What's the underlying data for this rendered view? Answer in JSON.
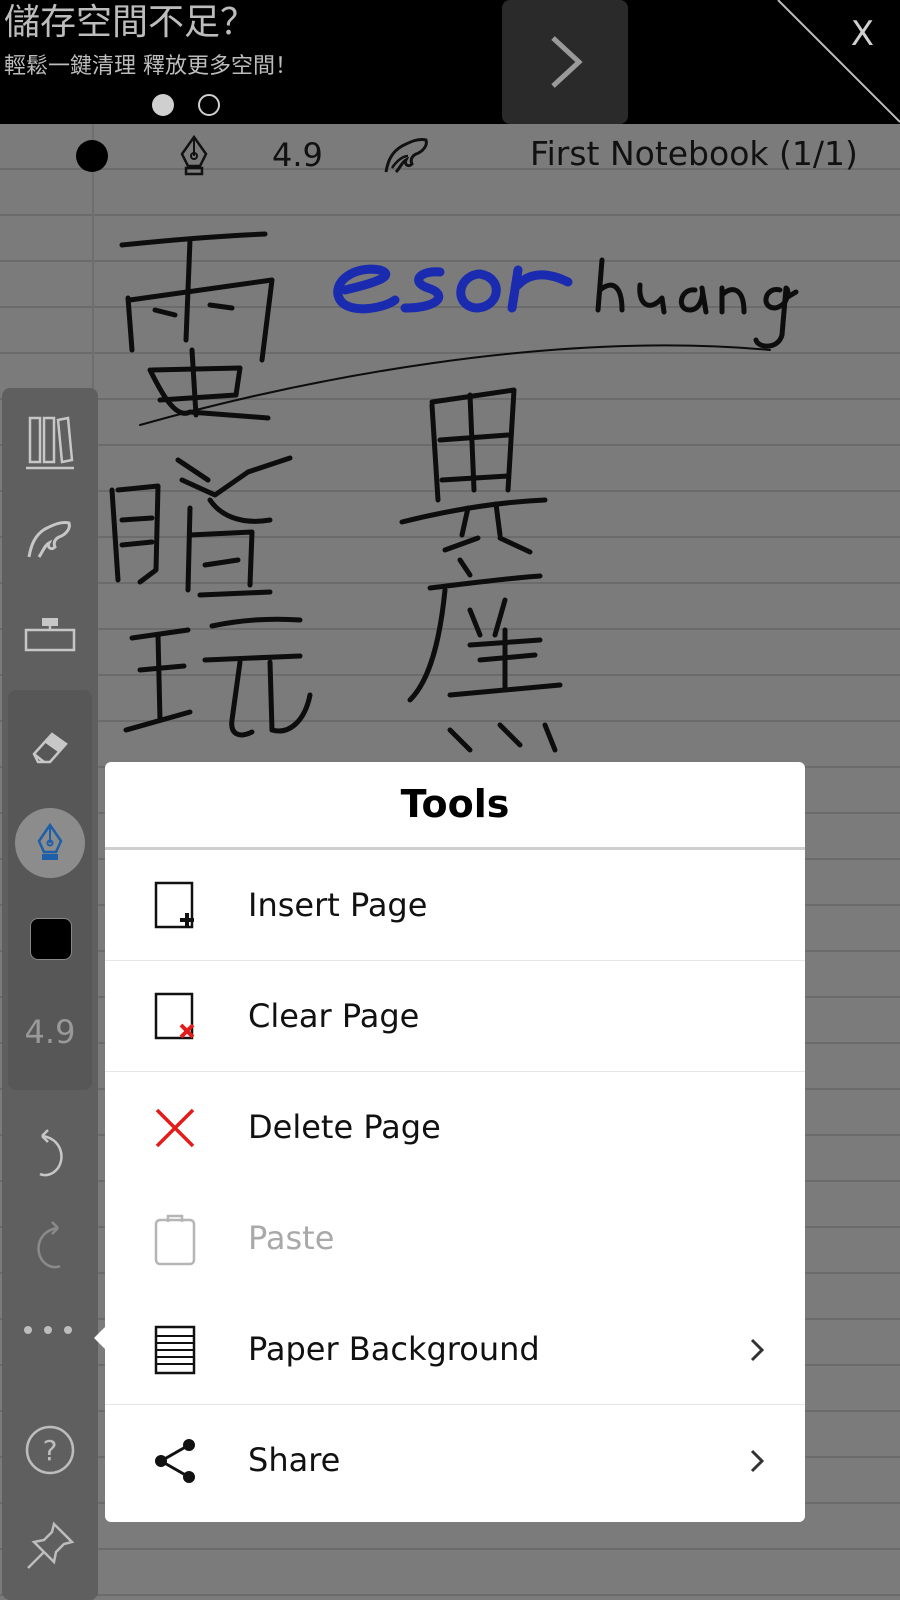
{
  "ad": {
    "title": "儲存空間不足？",
    "subtitle": "輕鬆一鍵清理 釋放更多空間！",
    "close_label": "X"
  },
  "toolbar": {
    "pen_size": "4.9",
    "notebook_title": "First Notebook (1/1)"
  },
  "sidebar": {
    "pen_size": "4.9"
  },
  "dialog": {
    "title": "Tools",
    "items": [
      {
        "label": "Insert Page",
        "icon": "insert-page-icon",
        "enabled": true
      },
      {
        "label": "Clear Page",
        "icon": "clear-page-icon",
        "enabled": true
      },
      {
        "label": "Delete Page",
        "icon": "delete-page-icon",
        "enabled": true
      },
      {
        "label": "Paste",
        "icon": "paste-icon",
        "enabled": false
      },
      {
        "label": "Paper Background",
        "icon": "paper-background-icon",
        "enabled": true,
        "submenu": true
      },
      {
        "label": "Share",
        "icon": "share-icon",
        "enabled": true,
        "submenu": true
      }
    ]
  },
  "colors": {
    "accent_red": "#e31b1b",
    "ink_blue": "#1a2bb0",
    "disabled_text": "#a9a9a9"
  }
}
